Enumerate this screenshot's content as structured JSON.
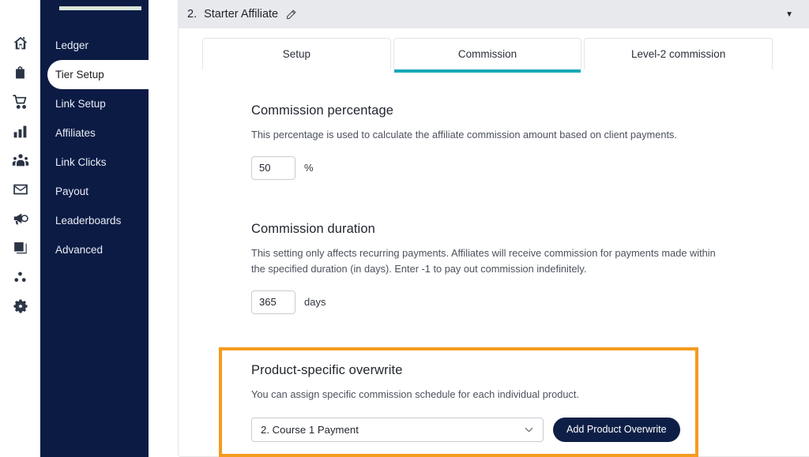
{
  "rail": {
    "icons": [
      {
        "name": "home-icon"
      },
      {
        "name": "shopping-bag-icon"
      },
      {
        "name": "shopping-cart-icon"
      },
      {
        "name": "bar-chart-icon"
      },
      {
        "name": "people-group-icon"
      },
      {
        "name": "envelope-icon"
      },
      {
        "name": "megaphone-icon"
      },
      {
        "name": "book-icon"
      },
      {
        "name": "network-dots-icon"
      },
      {
        "name": "gear-icon"
      }
    ]
  },
  "sidebar": {
    "items": [
      {
        "label": "Ledger",
        "active": false
      },
      {
        "label": "Tier Setup",
        "active": true
      },
      {
        "label": "Link Setup",
        "active": false
      },
      {
        "label": "Affiliates",
        "active": false
      },
      {
        "label": "Link Clicks",
        "active": false
      },
      {
        "label": "Payout",
        "active": false
      },
      {
        "label": "Leaderboards",
        "active": false
      },
      {
        "label": "Advanced",
        "active": false
      }
    ]
  },
  "header": {
    "index": "2.",
    "title": "Starter Affiliate",
    "edit_icon": "pencil-icon",
    "collapse_chevron": "▼"
  },
  "tabs": [
    {
      "label": "Setup",
      "active": false
    },
    {
      "label": "Commission",
      "active": true
    },
    {
      "label": "Level-2 commission",
      "active": false
    }
  ],
  "commission_percentage": {
    "title": "Commission percentage",
    "description": "This percentage is used to calculate the affiliate commission amount based on client payments.",
    "value": "50",
    "unit": "%"
  },
  "commission_duration": {
    "title": "Commission duration",
    "description": "This setting only affects recurring payments. Affiliates will receive commission for payments made within the specified duration (in days). Enter -1 to pay out commission indefinitely.",
    "value": "365",
    "unit": "days"
  },
  "product_overwrite": {
    "title": "Product-specific overwrite",
    "description": "You can assign specific commission schedule for each individual product.",
    "selected_product": "2. Course 1 Payment",
    "add_button_label": "Add Product Overwrite",
    "highlight_color": "#f59b20"
  },
  "colors": {
    "sidebar_bg": "#0b1b44",
    "accent_teal": "#17a8b8",
    "button_navy": "#0e1f47",
    "highlight_orange": "#f59b20",
    "header_strip": "#e8e9ec"
  }
}
